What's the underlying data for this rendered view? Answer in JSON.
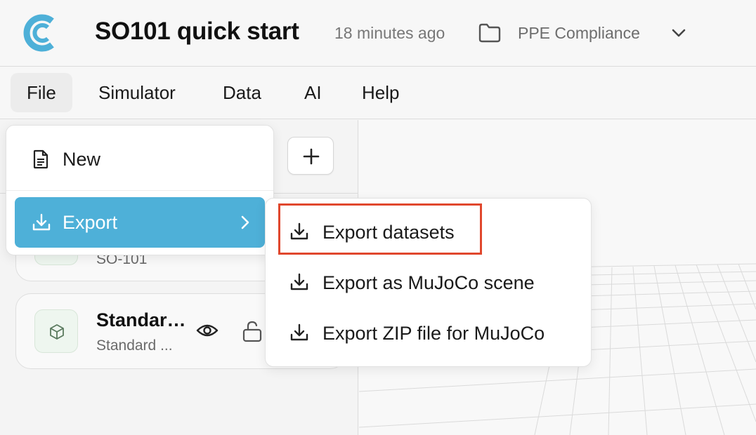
{
  "header": {
    "project_title": "SO101 quick start",
    "timestamp": "18 minutes ago",
    "folder_name": "PPE Compliance",
    "brand_color": "#4eb0d8"
  },
  "menubar": {
    "items": [
      {
        "label": "File",
        "active": true
      },
      {
        "label": "Simulator"
      },
      {
        "label": "Data"
      },
      {
        "label": "AI"
      },
      {
        "label": "Help"
      }
    ]
  },
  "file_menu": {
    "new_label": "New",
    "export_label": "Export",
    "export_highlight_color": "#4eb0d8"
  },
  "export_submenu": {
    "items": [
      {
        "label": "Export datasets",
        "icon": "download-icon",
        "outlined": true
      },
      {
        "label": "Export as MuJoCo scene",
        "icon": "download-icon"
      },
      {
        "label": "Export ZIP file for MuJoCo",
        "icon": "download-icon"
      }
    ],
    "outline_color": "#e0472d"
  },
  "assets": [
    {
      "name": "",
      "subtitle": "SO-101"
    },
    {
      "name": "Standard...",
      "subtitle": "Standard ..."
    }
  ]
}
